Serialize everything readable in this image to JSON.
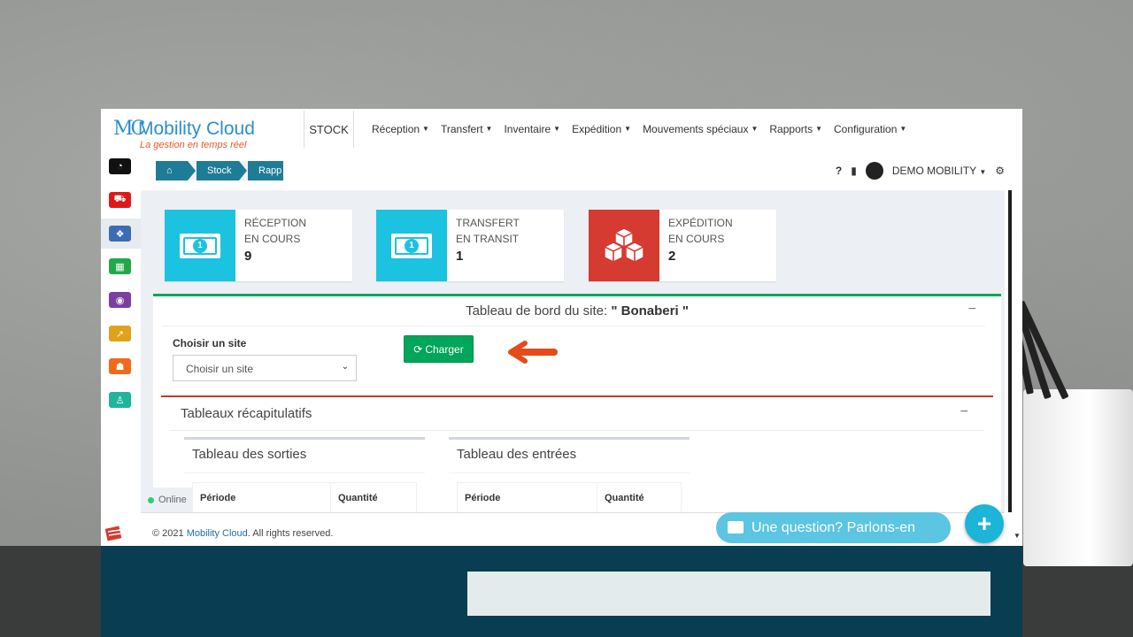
{
  "header": {
    "logo_name": "Mobility Cloud",
    "logo_tagline": "La gestion en temps réel",
    "module": "STOCK",
    "menu": [
      "Réception",
      "Transfert",
      "Inventaire",
      "Expédition",
      "Mouvements spéciaux",
      "Rapports",
      "Configuration"
    ]
  },
  "breadcrumb": [
    "Stock",
    "Rapp"
  ],
  "user": {
    "name": "DEMO MOBILITY"
  },
  "sidebar": {
    "icons": [
      {
        "name": "dashboard-icon",
        "color": "#111111"
      },
      {
        "name": "cart-icon",
        "color": "#dd1a1a"
      },
      {
        "name": "boxes-icon",
        "color": "#3c6cb4"
      },
      {
        "name": "calculator-icon",
        "color": "#22a84a"
      },
      {
        "name": "money-icon",
        "color": "#7b3fa1"
      },
      {
        "name": "chart-icon",
        "color": "#e0a21a"
      },
      {
        "name": "users-icon",
        "color": "#f06a1a"
      },
      {
        "name": "sitemap-icon",
        "color": "#1fb59a"
      }
    ]
  },
  "infoboxes": [
    {
      "line1": "RÉCEPTION",
      "line2": "EN COURS",
      "value": "9",
      "color": "#1cc3e0"
    },
    {
      "line1": "TRANSFERT",
      "line2": "EN TRANSIT",
      "value": "1",
      "color": "#1cc3e0"
    },
    {
      "line1": "EXPÉDITION",
      "line2": "EN COURS",
      "value": "2",
      "color": "#d63b31"
    }
  ],
  "site_panel": {
    "title_prefix": "Tableau de bord du site:",
    "site_name": "\" Bonaberi \"",
    "select_label": "Choisir un site",
    "select_value": "Choisir un site",
    "load_button": "Charger"
  },
  "recap_panel": {
    "title": "Tableaux récapitulatifs",
    "tables": [
      {
        "title": "Tableau des sorties",
        "columns": [
          "Période",
          "Quantité"
        ]
      },
      {
        "title": "Tableau des entrées",
        "columns": [
          "Période",
          "Quantité"
        ]
      }
    ]
  },
  "footer": {
    "prefix": "© 2021 ",
    "brand": "Mobility Cloud",
    "suffix": ". All rights reserved."
  },
  "status": {
    "online": "Online"
  },
  "chat": {
    "label": "Une question? Parlons-en",
    "fab": "+"
  }
}
